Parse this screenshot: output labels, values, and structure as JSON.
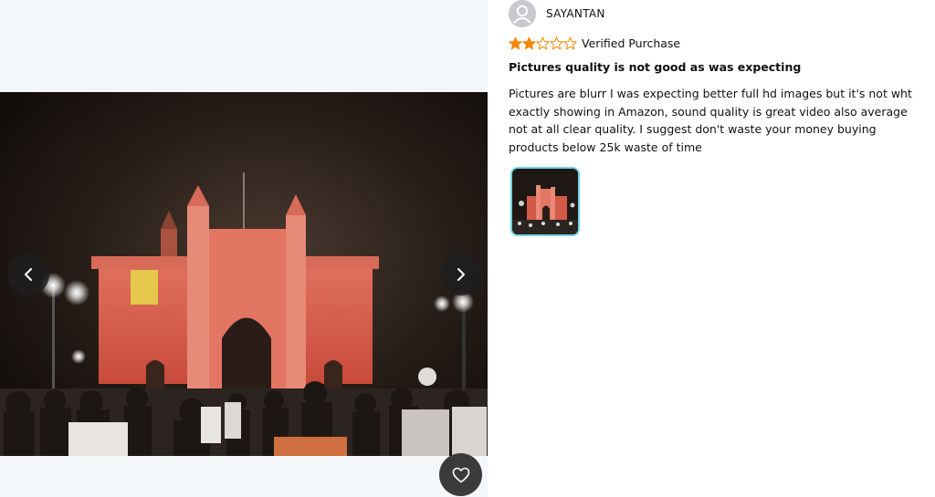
{
  "viewer": {
    "image_alt": "Gateway of India lit up at night with crowd",
    "prev_icon": "chevron-left-icon",
    "next_icon": "chevron-right-icon",
    "favorite_icon": "heart-icon"
  },
  "review": {
    "reviewer_name": "SAYANTAN",
    "avatar_icon": "user-icon",
    "rating": 2,
    "rating_max": 5,
    "star_color": "#f08804",
    "verified_label": "Verified Purchase",
    "title": "Pictures quality is not good as was expecting",
    "body": "Pictures are blurr I was expecting better full hd images but it's not wht exactly showing in Amazon, sound quality is great video also average not at all clear quality. I suggest don't waste your money buying products below 25k waste of time"
  },
  "thumbnails": [
    {
      "alt": "Gateway of India thumbnail",
      "selected": true,
      "border_color": "#6fd3e6"
    }
  ]
}
